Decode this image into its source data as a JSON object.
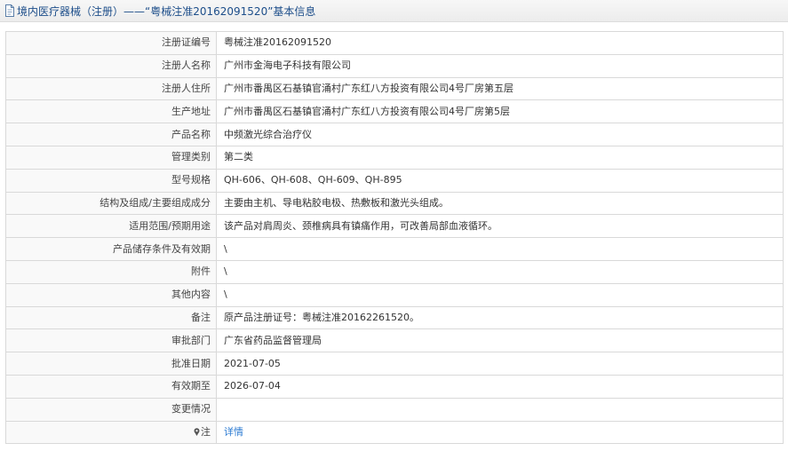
{
  "header": {
    "title": "境内医疗器械（注册）——“粤械注准20162091520”基本信息",
    "icon": "document-icon"
  },
  "rows": [
    {
      "label": "注册证编号",
      "value": "粤械注准20162091520"
    },
    {
      "label": "注册人名称",
      "value": "广州市金海电子科技有限公司"
    },
    {
      "label": "注册人住所",
      "value": "广州市番禺区石基镇官涌村广东红八方投资有限公司4号厂房第五层"
    },
    {
      "label": "生产地址",
      "value": "广州市番禺区石基镇官涌村广东红八方投资有限公司4号厂房第5层"
    },
    {
      "label": "产品名称",
      "value": "中频激光综合治疗仪"
    },
    {
      "label": "管理类别",
      "value": "第二类"
    },
    {
      "label": "型号规格",
      "value": "QH-606、QH-608、QH-609、QH-895"
    },
    {
      "label": "结构及组成/主要组成成分",
      "value": "主要由主机、导电粘胶电极、热敷板和激光头组成。"
    },
    {
      "label": "适用范围/预期用途",
      "value": "该产品对肩周炎、颈椎病具有镇痛作用，可改善局部血液循环。"
    },
    {
      "label": "产品储存条件及有效期",
      "value": "\\"
    },
    {
      "label": "附件",
      "value": "\\"
    },
    {
      "label": "其他内容",
      "value": "\\"
    },
    {
      "label": "备注",
      "value": "原产品注册证号：粤械注准20162261520。"
    },
    {
      "label": "审批部门",
      "value": "广东省药品监督管理局"
    },
    {
      "label": "批准日期",
      "value": "2021-07-05"
    },
    {
      "label": "有效期至",
      "value": "2026-07-04"
    },
    {
      "label": "变更情况",
      "value": ""
    }
  ],
  "note_row": {
    "label": "注",
    "icon": "pin-icon",
    "link_text": "详情"
  }
}
